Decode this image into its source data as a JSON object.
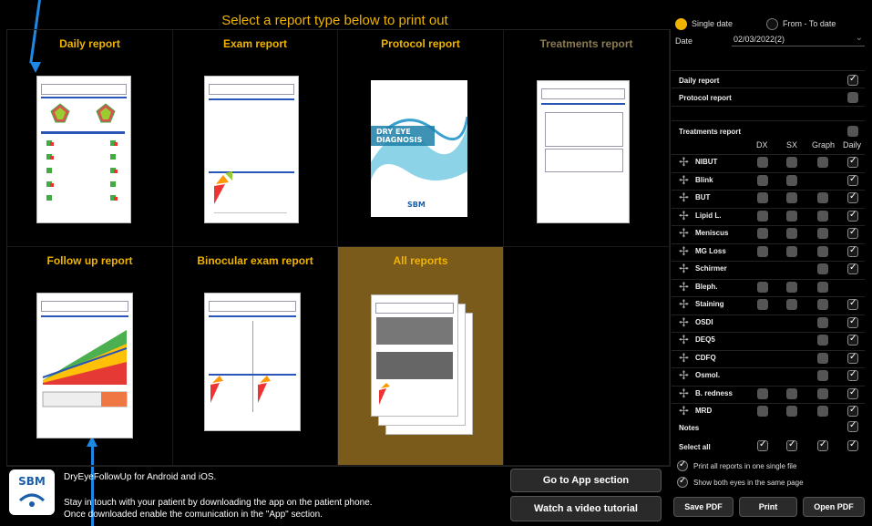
{
  "header": {
    "title": "Select a report type below to print out"
  },
  "reports": [
    {
      "label": "Daily report"
    },
    {
      "label": "Exam report"
    },
    {
      "label": "Protocol report"
    },
    {
      "label": "Treatments report"
    },
    {
      "label": "Follow up report"
    },
    {
      "label": "Binocular exam report"
    },
    {
      "label": "All reports"
    }
  ],
  "protocol_cover": {
    "line1": "DRY EYE",
    "line2": "DIAGNOSIS",
    "brand": "SBM"
  },
  "panel": {
    "single_date": "Single date",
    "from_to_date": "From - To date",
    "date_label": "Date",
    "date_value": "02/03/2022(2)",
    "daily_report": "Daily report",
    "protocol_report": "Protocol report",
    "treatments_report": "Treatments report",
    "columns": [
      "DX",
      "SX",
      "Graph",
      "Daily"
    ],
    "rows": [
      "NIBUT",
      "Blink",
      "BUT",
      "Lipid L.",
      "Meniscus",
      "MG Loss",
      "Schirmer",
      "Bleph.",
      "Staining",
      "OSDI",
      "DEQ5",
      "CDFQ",
      "Osmol.",
      "B. redness",
      "MRD"
    ],
    "notes": "Notes",
    "select_all": "Select all",
    "print_single": "Print all reports in one single file",
    "show_both": "Show both eyes in the same page",
    "save_pdf": "Save PDF",
    "print": "Print",
    "open_pdf": "Open PDF"
  },
  "footer": {
    "logo": "SBM",
    "line1": "DryEyeFollowUp for Android and iOS.",
    "line2": "Stay in touch with your patient by downloading the app on the patient phone.",
    "line3": "Once downloaded enable the comunication in the \"App\" section.",
    "go_app": "Go to App section",
    "watch_video": "Watch a video tutorial"
  },
  "colors": {
    "accent": "#f0b400",
    "selected_bg": "#7a5b1c",
    "arrow": "#1e88e5"
  }
}
